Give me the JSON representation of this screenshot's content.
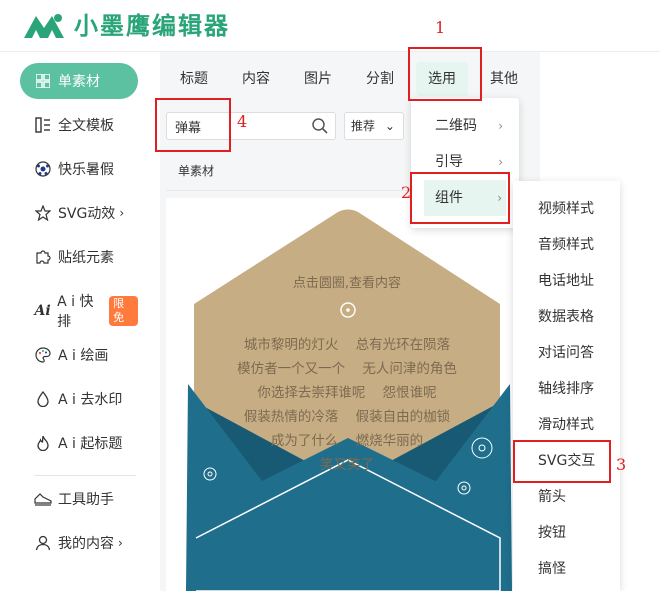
{
  "app": {
    "logo_text": "小墨鹰编辑器"
  },
  "sidebar": {
    "items": [
      {
        "label": "单素材",
        "icon": "grid-icon"
      },
      {
        "label": "全文模板",
        "icon": "layout-icon"
      },
      {
        "label": "快乐暑假",
        "icon": "ball-icon"
      },
      {
        "label": "SVG动效",
        "icon": "star-icon",
        "chevron": "›"
      },
      {
        "label": "贴纸元素",
        "icon": "puzzle-icon"
      },
      {
        "label": "A i 快排",
        "icon": "ai-icon",
        "badge": "限免"
      },
      {
        "label": "A i 绘画",
        "icon": "palette-icon"
      },
      {
        "label": "A i 去水印",
        "icon": "drop-icon"
      },
      {
        "label": "A i 起标题",
        "icon": "flame-icon"
      },
      {
        "label": "工具助手",
        "icon": "shoe-icon"
      },
      {
        "label": "我的内容",
        "icon": "user-icon",
        "chevron": "›"
      }
    ]
  },
  "tabs": [
    "标题",
    "内容",
    "图片",
    "分割",
    "选用",
    "其他"
  ],
  "search": {
    "value": "弹幕",
    "sort_label": "推荐",
    "sort_chevron": "⌄"
  },
  "section": {
    "label": "单素材"
  },
  "card": {
    "prompt": "点击圆圈,查看内容",
    "lines": [
      "城市黎明的灯火    总有光环在陨落",
      "模仿者一个又一个    无人问津的角色",
      "你选择去崇拜谁呢    怨恨谁呢",
      "假装热情的冷落    假装自由的枷锁",
      "成为了什么    燃烧华丽的",
      "笑又笑了"
    ],
    "colors": {
      "paper": "#c7ad84",
      "envelope": "#1f6e8c",
      "envelope_dark": "#185a73",
      "text": "#7c6a50"
    }
  },
  "menu1": {
    "items": [
      {
        "label": "二维码",
        "arrow": "›"
      },
      {
        "label": "引导",
        "arrow": "›"
      },
      {
        "label": "组件",
        "arrow": "›"
      }
    ]
  },
  "menu2": {
    "items": [
      "视频样式",
      "音频样式",
      "电话地址",
      "数据表格",
      "对话问答",
      "轴线排序",
      "滑动样式",
      "SVG交互",
      "箭头",
      "按钮",
      "搞怪"
    ]
  },
  "annotations": [
    "1",
    "2",
    "3",
    "4"
  ],
  "colors": {
    "accent": "#5cc1a0",
    "brand": "#2aa57a",
    "annotation": "#e02020",
    "badge": "#ff7a3d"
  }
}
